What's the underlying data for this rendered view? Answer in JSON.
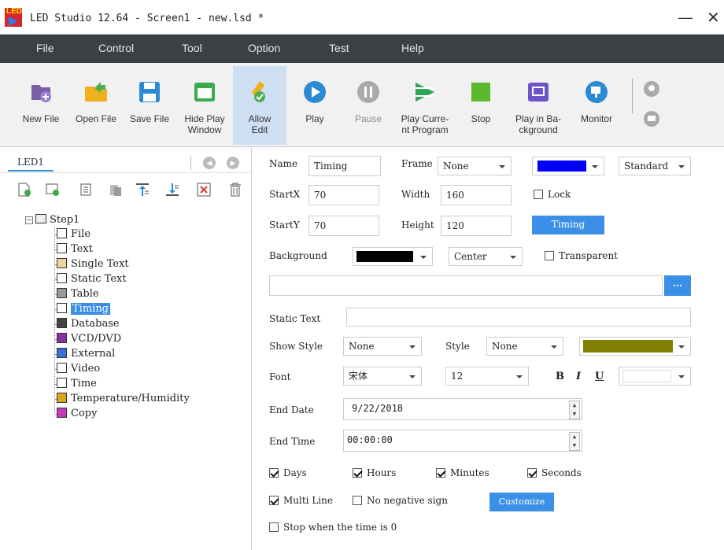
{
  "window": {
    "title": "LED Studio 12.64 - Screen1 - new.lsd *",
    "logo_text": "LED",
    "minimize": "—",
    "close": "✕"
  },
  "menu": [
    "File",
    "Control",
    "Tool",
    "Option",
    "Test",
    "Help"
  ],
  "toolbar": [
    {
      "id": "new-file",
      "label": "New File",
      "icon": "new-file-icon"
    },
    {
      "id": "open-file",
      "label": "Open File",
      "icon": "open-folder-icon"
    },
    {
      "id": "save-file",
      "label": "Save File",
      "icon": "save-icon"
    },
    {
      "id": "hide-play-window",
      "label": "Hide Play\nWindow",
      "icon": "window-icon"
    },
    {
      "id": "allow-edit",
      "label": "Allow\nEdit",
      "icon": "edit-pencil-icon"
    },
    {
      "id": "play",
      "label": "Play",
      "icon": "play-icon"
    },
    {
      "id": "pause",
      "label": "Pause",
      "icon": "pause-icon"
    },
    {
      "id": "play-current-program",
      "label": "Play Curre-\nnt Program",
      "icon": "play-current-icon"
    },
    {
      "id": "stop",
      "label": "Stop",
      "icon": "stop-icon"
    },
    {
      "id": "play-background",
      "label": "Play in Ba-\nckground",
      "icon": "background-play-icon"
    },
    {
      "id": "monitor",
      "label": "Monitor",
      "icon": "monitor-icon"
    }
  ],
  "left": {
    "tab": "LED1",
    "tree_root": "Step1",
    "tree_items": [
      "File",
      "Text",
      "Single Text",
      "Static Text",
      "Table",
      "Timing",
      "Database",
      "VCD/DVD",
      "External",
      "Video",
      "Time",
      "Temperature/Humidity",
      "Copy"
    ],
    "selected": "Timing"
  },
  "props": {
    "name_label": "Name",
    "name_value": "Timing",
    "frame_label": "Frame",
    "frame_value": "None",
    "frame_color": "#0000ff",
    "standard_value": "Standard",
    "startx_label": "StartX",
    "startx_value": "70",
    "width_label": "Width",
    "width_value": "160",
    "lock_label": "Lock",
    "starty_label": "StartY",
    "starty_value": "70",
    "height_label": "Height",
    "height_value": "120",
    "timing_btn": "Timing",
    "background_label": "Background",
    "background_color": "#000000",
    "align_value": "Center",
    "transparent_label": "Transparent",
    "browse_btn": "···",
    "static_text_label": "Static Text",
    "static_text_value": "",
    "show_style_label": "Show Style",
    "show_style_value": "None",
    "style_label": "Style",
    "style_value": "None",
    "style_color": "#808000",
    "font_label": "Font",
    "font_value": "宋体",
    "font_size": "12",
    "bold": "B",
    "italic": "I",
    "underline": "U",
    "font_color": "#ffffff",
    "end_date_label": "End Date",
    "end_date_value": "9/22/2018",
    "end_time_label": "End Time",
    "end_time_value": "00:00:00",
    "days_label": "Days",
    "hours_label": "Hours",
    "minutes_label": "Minutes",
    "seconds_label": "Seconds",
    "multiline_label": "Multi Line",
    "no_negative_label": "No negative sign",
    "customize_btn": "Customize",
    "stop_zero_label": "Stop when the time is 0"
  }
}
